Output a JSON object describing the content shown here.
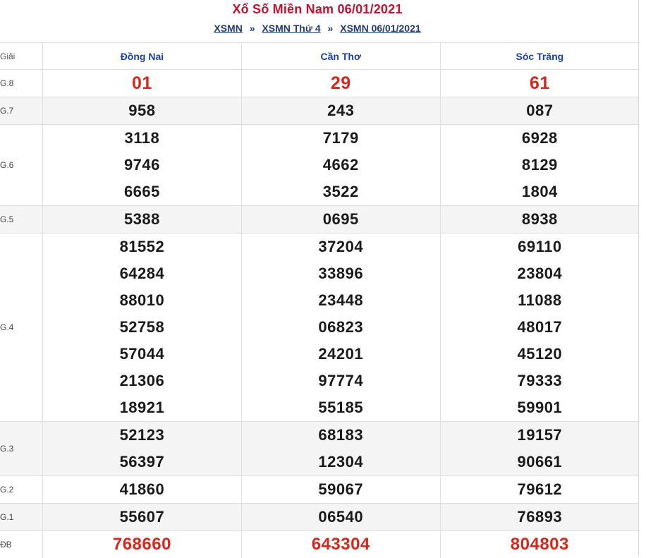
{
  "header": {
    "title": "Xổ Số Miền Nam 06/01/2021",
    "breadcrumb": [
      "XSMN",
      "XSMN Thứ 4",
      "XSMN 06/01/2021"
    ],
    "separator": "»"
  },
  "table": {
    "label_header": "Giải",
    "provinces": [
      "Đồng Nai",
      "Cần Thơ",
      "Sóc Trăng"
    ],
    "rows": [
      {
        "label": "G.8",
        "values": [
          [
            "01"
          ],
          [
            "29"
          ],
          [
            "61"
          ]
        ]
      },
      {
        "label": "G.7",
        "values": [
          [
            "958"
          ],
          [
            "243"
          ],
          [
            "087"
          ]
        ]
      },
      {
        "label": "G.6",
        "values": [
          [
            "3118",
            "9746",
            "6665"
          ],
          [
            "7179",
            "4662",
            "3522"
          ],
          [
            "6928",
            "8129",
            "1804"
          ]
        ]
      },
      {
        "label": "G.5",
        "values": [
          [
            "5388"
          ],
          [
            "0695"
          ],
          [
            "8938"
          ]
        ]
      },
      {
        "label": "G.4",
        "values": [
          [
            "81552",
            "64284",
            "88010",
            "52758",
            "57044",
            "21306",
            "18921"
          ],
          [
            "37204",
            "33896",
            "23448",
            "06823",
            "24201",
            "97774",
            "55185"
          ],
          [
            "69110",
            "23804",
            "11088",
            "48017",
            "45120",
            "79333",
            "59901"
          ]
        ]
      },
      {
        "label": "G.3",
        "values": [
          [
            "52123",
            "56397"
          ],
          [
            "68183",
            "12304"
          ],
          [
            "19157",
            "90661"
          ]
        ]
      },
      {
        "label": "G.2",
        "values": [
          [
            "41860"
          ],
          [
            "59067"
          ],
          [
            "79612"
          ]
        ]
      },
      {
        "label": "G.1",
        "values": [
          [
            "55607"
          ],
          [
            "06540"
          ],
          [
            "76893"
          ]
        ]
      },
      {
        "label": "ĐB",
        "values": [
          [
            "768660"
          ],
          [
            "643304"
          ],
          [
            "804803"
          ]
        ]
      }
    ]
  },
  "colors": {
    "title": "#c8102e",
    "province_header": "#1a3fa6",
    "highlight_number": "#d7261c",
    "row_alt_bg": "#f4f4f4"
  }
}
